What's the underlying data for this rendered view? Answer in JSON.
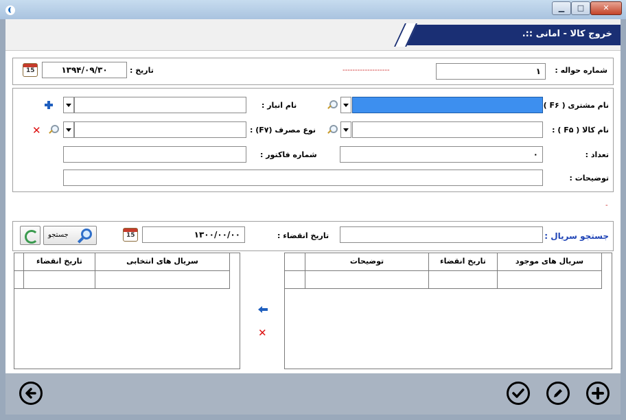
{
  "window": {
    "title": ".:: خروج کالا - امانی",
    "buttons": {
      "minimize": "▁",
      "maximize": "□",
      "close": "✕"
    }
  },
  "header": {
    "transfer_label": "شماره حواله :",
    "transfer_value": "۱",
    "date_label": "تاریخ :",
    "date_value": "۱۳۹۴/۰۹/۳۰",
    "dashes": "-------------------",
    "calendar_day": "15"
  },
  "form": {
    "customer_label": "نام مشتری ( F۶ ) :",
    "customer_value": "",
    "warehouse_label": "نام انبار :",
    "warehouse_value": "",
    "product_label": "نام کالا ( F۵ ) :",
    "product_value": "",
    "usage_label": "نوع مصرف (F۷) :",
    "usage_value": "",
    "count_label": "تعداد :",
    "count_value": "۰",
    "invoice_label": "شماره فاکتور :",
    "invoice_value": "",
    "notes_label": "توضیحات :",
    "notes_value": ""
  },
  "separator_dash": "-",
  "serial_search": {
    "label": "جستجو سریال :",
    "value": "",
    "expiry_label": "تاریخ انقضاء :",
    "expiry_value": "۱۳۰۰/۰۰/۰۰",
    "search_button": "جستجو",
    "calendar_day": "15"
  },
  "available_grid": {
    "headers": [
      "سریال های موجود",
      "تاریخ انقضاء",
      "توضیحات"
    ]
  },
  "selected_grid": {
    "headers": [
      "سریال های انتخابی",
      "تاریخ انقضاء"
    ]
  },
  "colors": {
    "title_bg": "#1a2f74",
    "selected_field": "#3d8fef",
    "footer_bg": "#a9b4c2"
  },
  "icons": {
    "back": "arrow-left-circle-icon",
    "confirm": "check-circle-icon",
    "edit": "pencil-circle-icon",
    "add": "plus-circle-icon"
  }
}
